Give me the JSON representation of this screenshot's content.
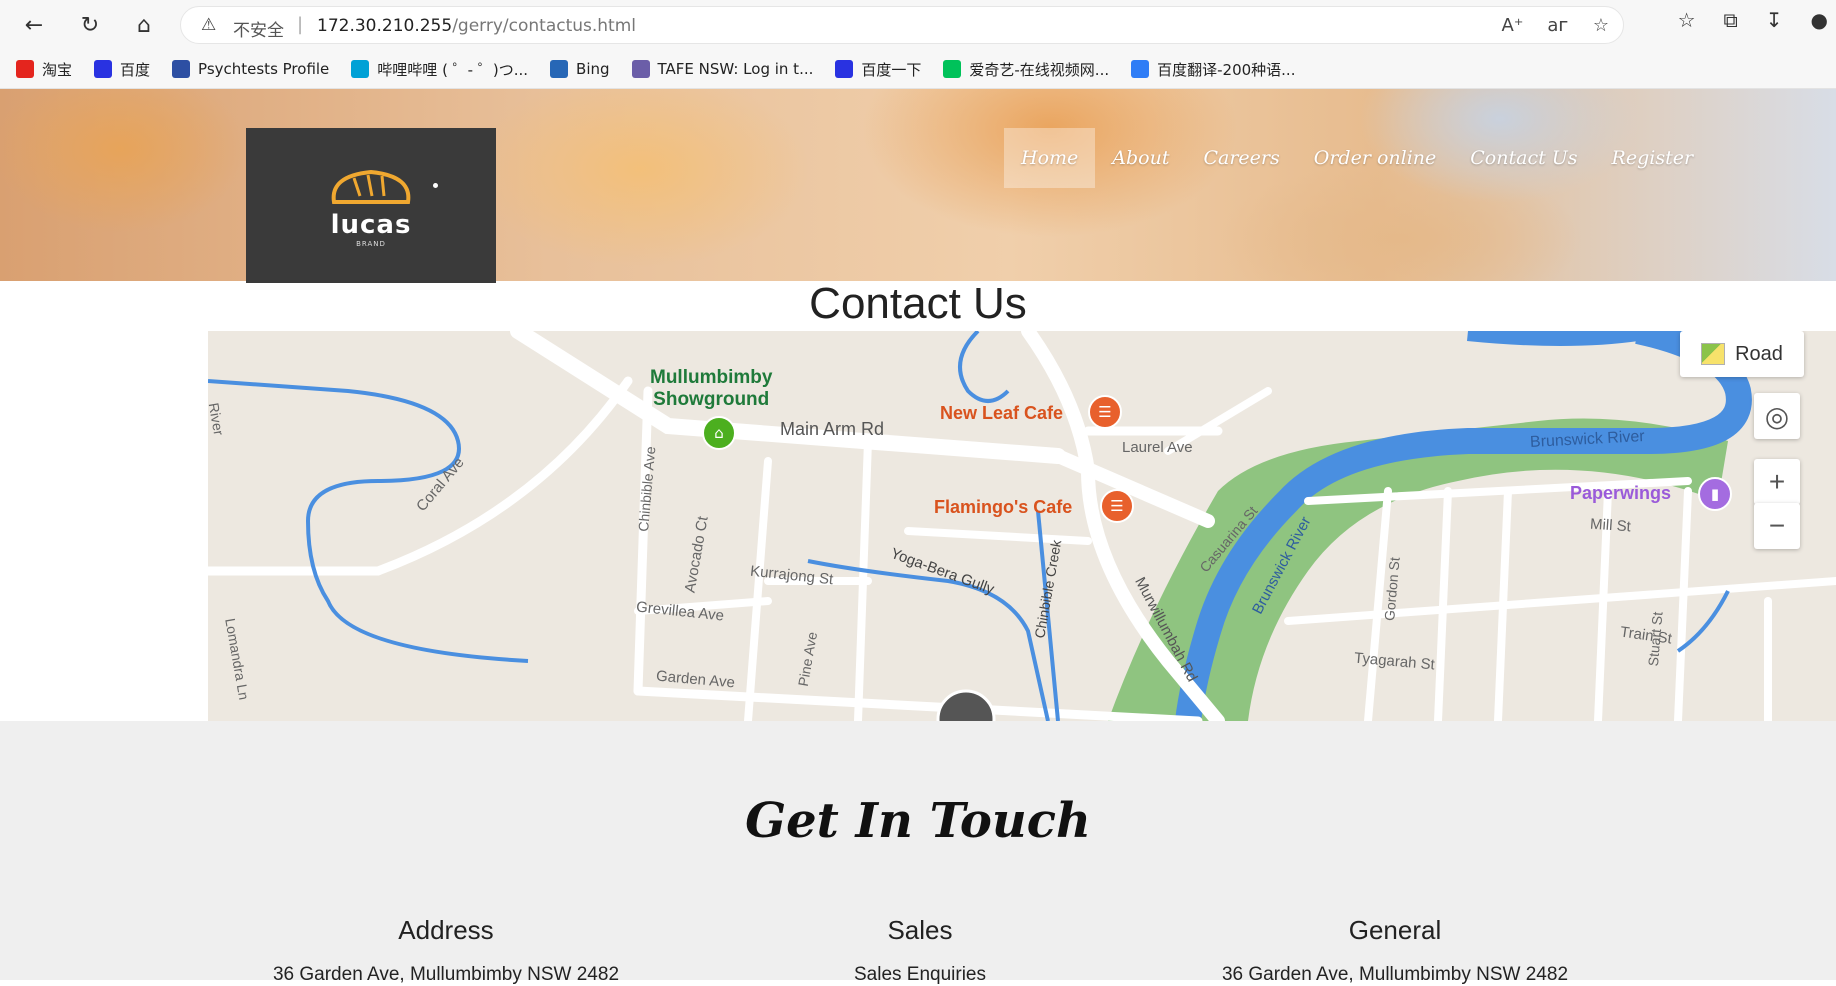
{
  "browser": {
    "security_label": "不安全",
    "url_host": "172.30.210.255",
    "url_path": "/gerry/contactus.html",
    "bookmarks": [
      {
        "label": "淘宝",
        "icon": "taobao-icon",
        "color": "#e4251e"
      },
      {
        "label": "百度",
        "icon": "baidu-paw-icon",
        "color": "#2932e1"
      },
      {
        "label": "Psychtests Profile",
        "icon": "psychtests-icon",
        "color": "#2d4fa3"
      },
      {
        "label": "哔哩哔哩 ( ゜- ゜)つ...",
        "icon": "bilibili-icon",
        "color": "#00a1d6"
      },
      {
        "label": "Bing",
        "icon": "search-icon",
        "color": "#2767b6"
      },
      {
        "label": "TAFE NSW: Log in t...",
        "icon": "tafe-icon",
        "color": "#6b5ea8"
      },
      {
        "label": "百度一下",
        "icon": "baidu-paw-icon",
        "color": "#2932e1"
      },
      {
        "label": "爱奇艺-在线视频网...",
        "icon": "iqiyi-icon",
        "color": "#00c25a"
      },
      {
        "label": "百度翻译-200种语...",
        "icon": "translate-icon",
        "color": "#2f7df6"
      }
    ]
  },
  "site": {
    "logo_text": "lucas",
    "logo_sub": "BRAND",
    "nav": [
      {
        "label": "Home",
        "active": true
      },
      {
        "label": "About",
        "active": false
      },
      {
        "label": "Careers",
        "active": false
      },
      {
        "label": "Order online",
        "active": false
      },
      {
        "label": "Contact Us",
        "active": false
      },
      {
        "label": "Register",
        "active": false
      }
    ],
    "page_title": "Contact Us"
  },
  "map": {
    "type_button": "Road",
    "zoom_in": "+",
    "zoom_out": "−",
    "labels": {
      "showground": "Mullumbimby\nShowground",
      "main_arm": "Main Arm Rd",
      "new_leaf": "New Leaf Cafe",
      "laurel": "Laurel Ave",
      "flamingo": "Flamingo's Cafe",
      "coral": "Coral Ave",
      "chinbible_ave": "Chinbible Ave",
      "avocado": "Avocado Ct",
      "kurrajong": "Kurrajong St",
      "grevillea": "Grevillea Ave",
      "garden": "Garden Ave",
      "pine": "Pine Ave",
      "yoga_bera": "Yoga-Bera Gully",
      "chinbible_creek": "Chinbible Creek",
      "murwillumbah": "Murwillumbah Rd",
      "casuarina": "Casuarina St",
      "brunswick_river_v": "Brunswick River",
      "brunswick_river_h": "Brunswick River",
      "paperwings": "Paperwings",
      "mill": "Mill St",
      "gordon": "Gordon St",
      "tyagarah": "Tyagarah St",
      "stuart": "Stuart St",
      "train": "Train St",
      "lomandra": "Lomandra Ln",
      "river_left": "River"
    },
    "colors": {
      "land": "#ede8e0",
      "water": "#4a8fe0",
      "park": "#8fc480",
      "road": "#ffffff",
      "poi_food": "#e8602c",
      "poi_park": "#4caf1f",
      "poi_shop": "#a46ce0"
    }
  },
  "touch": {
    "title": "Get In Touch",
    "columns": [
      {
        "heading": "Address",
        "text": "36 Garden Ave, Mullumbimby NSW 2482"
      },
      {
        "heading": "Sales",
        "text": "Sales Enquiries"
      },
      {
        "heading": "General",
        "text": "36 Garden Ave, Mullumbimby NSW 2482"
      }
    ]
  }
}
